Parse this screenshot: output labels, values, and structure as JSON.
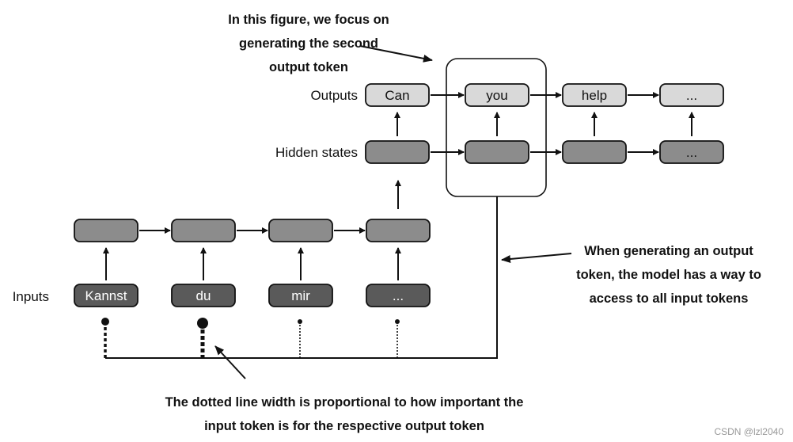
{
  "labels": {
    "outputs": "Outputs",
    "hidden_states": "Hidden states",
    "inputs": "Inputs"
  },
  "outputs": [
    "Can",
    "you",
    "help",
    "..."
  ],
  "hidden_states": [
    "",
    "",
    "",
    "..."
  ],
  "encoder_states": [
    "",
    "",
    "",
    ""
  ],
  "inputs": [
    "Kannst",
    "du",
    "mir",
    "..."
  ],
  "input_importance": [
    "medium",
    "high",
    "low",
    "low"
  ],
  "annotations": {
    "top": [
      "In this figure, we focus on",
      "generating the second",
      "output token"
    ],
    "right": [
      "When generating an output",
      "token, the model has a way to",
      "access to all input tokens"
    ],
    "bottom": [
      "The dotted line width is proportional to how important the",
      "input token is for the respective output token"
    ]
  },
  "watermark": "CSDN @lzl2040",
  "colors": {
    "output_fill": "#d9d9d9",
    "hidden_fill": "#8c8c8c",
    "input_fill": "#5a5a5a",
    "stroke": "#111111"
  }
}
